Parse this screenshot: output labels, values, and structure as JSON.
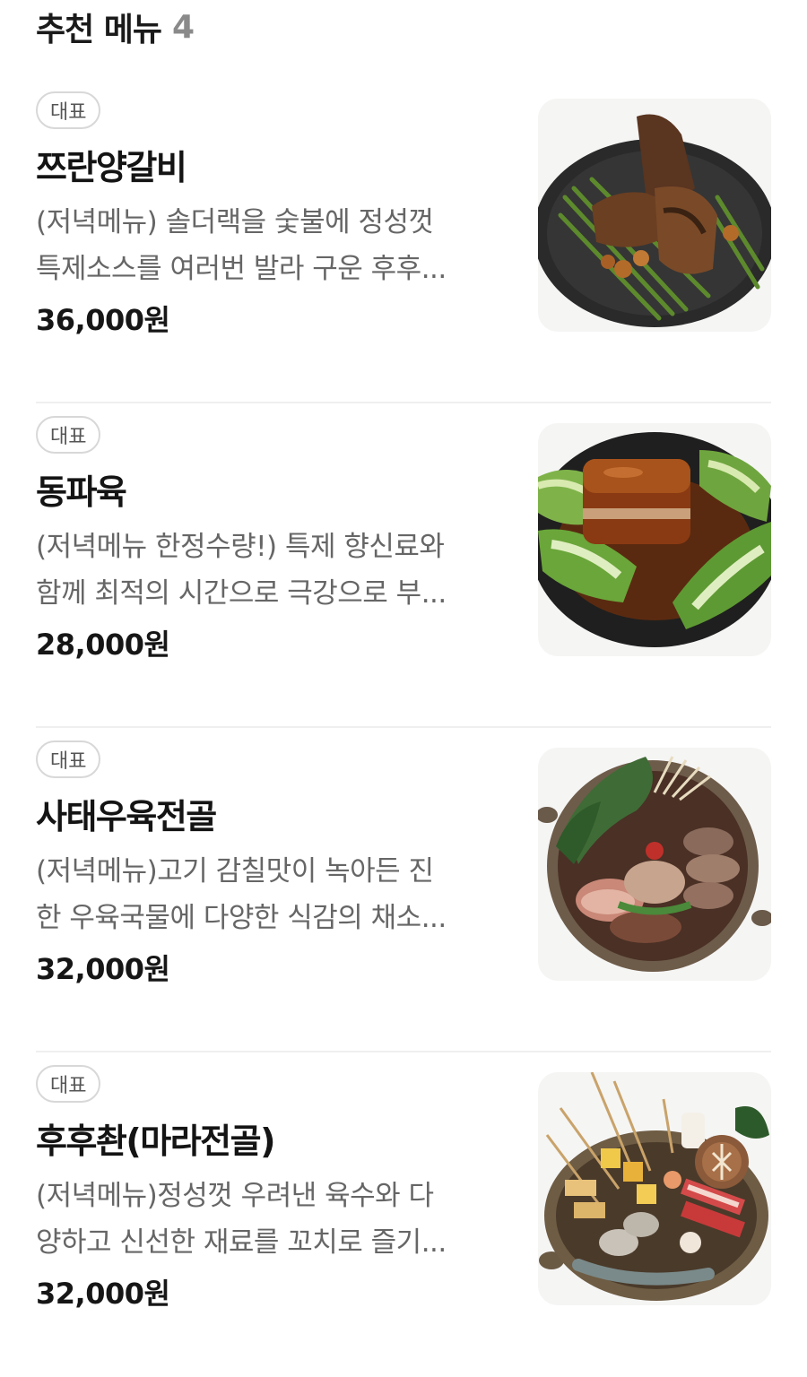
{
  "section": {
    "title": "추천 메뉴",
    "count": "4"
  },
  "items": [
    {
      "badge": "대표",
      "name": "쯔란양갈비",
      "desc_line1": "(저녁메뉴) 솔더랙을 숯불에 정성껏",
      "desc_line2": "특제소스를 여러번 발라 구운 후후...",
      "price": "36,000원",
      "image_icon": "lamb-ribs-dish"
    },
    {
      "badge": "대표",
      "name": "동파육",
      "desc_line1": "(저녁메뉴 한정수량!) 특제 향신료와",
      "desc_line2": "함께 최적의 시간으로 극강으로 부...",
      "price": "28,000원",
      "image_icon": "braised-pork-dish"
    },
    {
      "badge": "대표",
      "name": "사태우육전골",
      "desc_line1": "(저녁메뉴)고기 감칠맛이 녹아든 진",
      "desc_line2": "한 우육국물에 다양한 식감의 채소...",
      "price": "32,000원",
      "image_icon": "beef-hotpot-dish"
    },
    {
      "badge": "대표",
      "name": "후후촨(마라전골)",
      "desc_line1": "(저녁메뉴)정성껏 우려낸 육수와 다",
      "desc_line2": "양하고 신선한 재료를 꼬치로 즐기...",
      "price": "32,000원",
      "image_icon": "mala-skewer-hotpot-dish"
    }
  ]
}
